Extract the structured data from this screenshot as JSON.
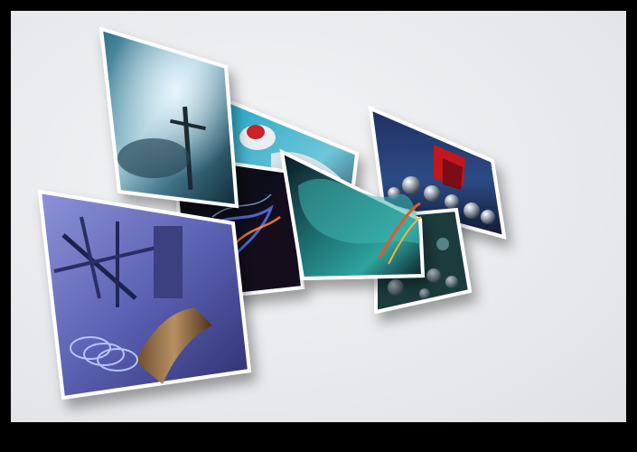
{
  "scene": {
    "description_icon": "image-gallery-icon",
    "background_color": "#e9eaed",
    "frame_color": "#000000",
    "photo_border_color": "#ffffff"
  }
}
